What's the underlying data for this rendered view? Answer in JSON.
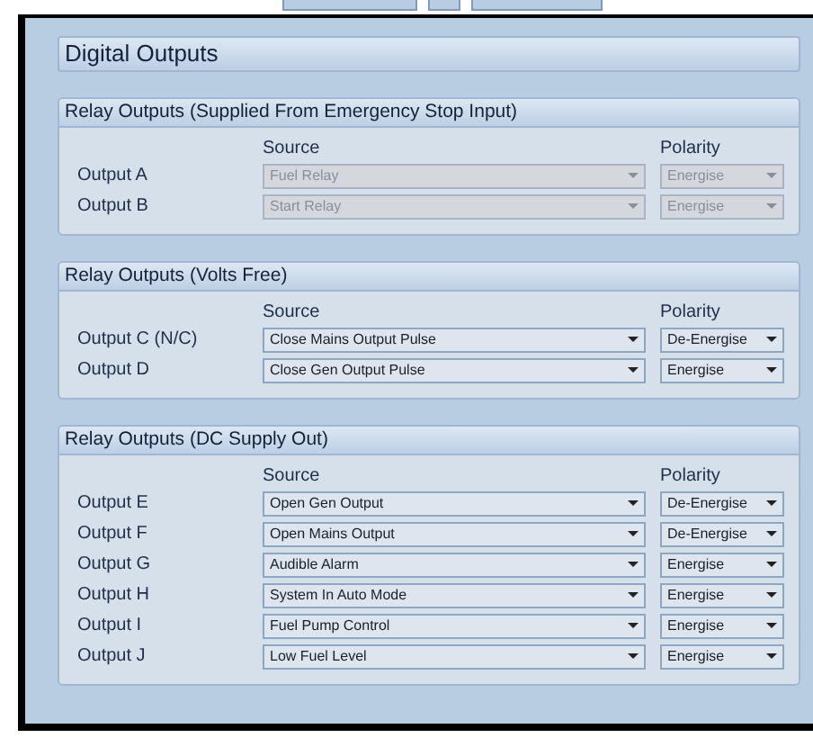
{
  "title": "Digital Outputs",
  "sections": [
    {
      "title": "Relay Outputs (Supplied From Emergency Stop Input)",
      "source_heading": "Source",
      "polarity_heading": "Polarity",
      "rows": [
        {
          "label": "Output A",
          "source": "Fuel Relay",
          "polarity": "Energise",
          "disabled": true
        },
        {
          "label": "Output B",
          "source": "Start Relay",
          "polarity": "Energise",
          "disabled": true
        }
      ]
    },
    {
      "title": "Relay Outputs (Volts Free)",
      "source_heading": "Source",
      "polarity_heading": "Polarity",
      "rows": [
        {
          "label": "Output C (N/C)",
          "source": "Close Mains Output Pulse",
          "polarity": "De-Energise",
          "disabled": false
        },
        {
          "label": "Output D",
          "source": "Close Gen Output Pulse",
          "polarity": "Energise",
          "disabled": false
        }
      ]
    },
    {
      "title": "Relay Outputs (DC Supply Out)",
      "source_heading": "Source",
      "polarity_heading": "Polarity",
      "rows": [
        {
          "label": "Output E",
          "source": "Open Gen Output",
          "polarity": "De-Energise",
          "disabled": false
        },
        {
          "label": "Output F",
          "source": "Open Mains Output",
          "polarity": "De-Energise",
          "disabled": false
        },
        {
          "label": "Output G",
          "source": "Audible Alarm",
          "polarity": "Energise",
          "disabled": false
        },
        {
          "label": "Output H",
          "source": "System In Auto Mode",
          "polarity": "Energise",
          "disabled": false
        },
        {
          "label": "Output I",
          "source": "Fuel Pump Control",
          "polarity": "Energise",
          "disabled": false
        },
        {
          "label": "Output J",
          "source": "Low Fuel Level",
          "polarity": "Energise",
          "disabled": false
        }
      ]
    }
  ]
}
